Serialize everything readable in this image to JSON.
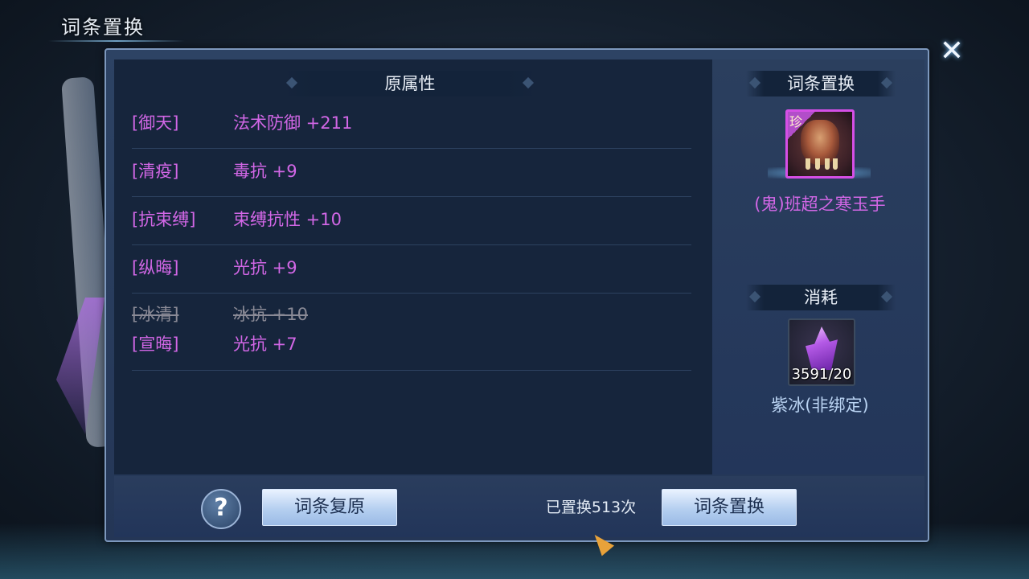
{
  "window": {
    "title": "词条置换",
    "close_label": "✕"
  },
  "left_header": "原属性",
  "attributes": [
    {
      "key": "[御天]",
      "value": "法术防御 +211"
    },
    {
      "key": "[清疫]",
      "value": "毒抗 +9"
    },
    {
      "key": "[抗束缚]",
      "value": "束缚抗性 +10"
    },
    {
      "key": "[纵晦]",
      "value": "光抗 +9"
    }
  ],
  "replaced_attribute": {
    "old_key": "[冰清]",
    "old_value": "冰抗 +10",
    "new_key": "[宣晦]",
    "new_value": "光抗 +7"
  },
  "right": {
    "header": "词条置换",
    "equipment": {
      "rarity": "珍",
      "name": "(鬼)班超之寒玉手",
      "name_color": "#d267e6",
      "icon": "claw-gauntlet-icon"
    },
    "consume_header": "消耗",
    "material": {
      "name": "紫冰(非绑定)",
      "count": "3591/20",
      "name_color": "#b9d3f2",
      "icon": "purple-crystal-icon"
    }
  },
  "footer": {
    "help_label": "?",
    "restore_label": "词条复原",
    "count_text": "已置换513次",
    "replace_label": "词条置换"
  }
}
